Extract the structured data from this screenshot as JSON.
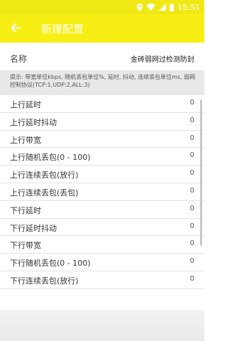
{
  "status_bar": {
    "time": "15:51"
  },
  "app_bar": {
    "title": "新建配置"
  },
  "name_field": {
    "label": "名称",
    "value": "金砖弱网过检测防封"
  },
  "hint": "提示: 带宽单位kbps, 随机丢包单位%, 延时, 抖动, 连续丢包单位ms, 弱网控制协议(TCP:1,UDP:2,ALL:3)",
  "settings": [
    {
      "label": "上行延时",
      "value": "0"
    },
    {
      "label": "上行延时抖动",
      "value": "0"
    },
    {
      "label": "上行带宽",
      "value": "0"
    },
    {
      "label": "上行随机丢包(0 - 100)",
      "value": "0"
    },
    {
      "label": "上行连续丢包(放行)",
      "value": "0"
    },
    {
      "label": "上行连续丢包(丢包)",
      "value": "0"
    },
    {
      "label": "下行延时",
      "value": "0"
    },
    {
      "label": "下行延时抖动",
      "value": "0"
    },
    {
      "label": "下行带宽",
      "value": "0"
    },
    {
      "label": "下行随机丢包(0 - 100)",
      "value": "0"
    },
    {
      "label": "下行连续丢包(放行)",
      "value": "0"
    }
  ],
  "colors": {
    "accent": "#f7ee14"
  },
  "icons": {
    "back": "arrow-back-icon",
    "location": "location-icon",
    "wifi": "wifi-icon",
    "signal": "signal-icon",
    "battery": "battery-icon"
  }
}
